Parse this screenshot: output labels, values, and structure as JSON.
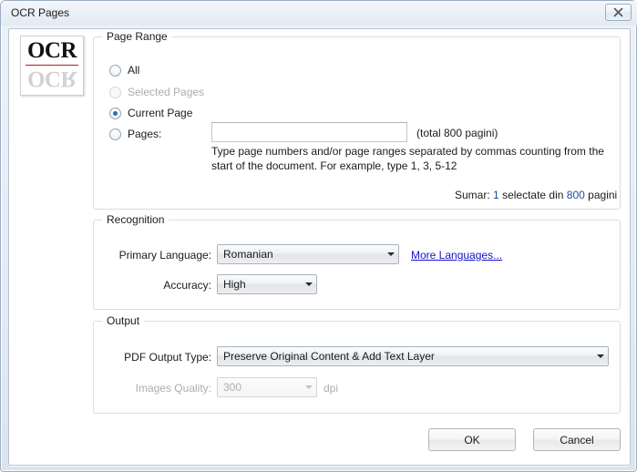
{
  "window": {
    "title": "OCR Pages",
    "close_glyph": "✖"
  },
  "logo": {
    "top_text": "OCR",
    "bottom_text": "OCR"
  },
  "page_range": {
    "title": "Page Range",
    "options": [
      {
        "label": "All",
        "selected": false,
        "disabled": false
      },
      {
        "label": "Selected Pages",
        "selected": false,
        "disabled": true
      },
      {
        "label": "Current Page",
        "selected": true,
        "disabled": false
      },
      {
        "label": "Pages:",
        "selected": false,
        "disabled": false
      }
    ],
    "pages_value": "",
    "pages_placeholder": "",
    "total_label": "(total 800 pagini)",
    "hint": "Type page numbers and/or page ranges separated by commas counting from the start of the document. For example, type 1, 3, 5-12",
    "summary": {
      "prefix": "Sumar:",
      "selected_count": "1",
      "middle": "selectate din",
      "total_count": "800",
      "suffix": "pagini"
    }
  },
  "recognition": {
    "title": "Recognition",
    "primary_language_label": "Primary Language:",
    "primary_language_value": "Romanian",
    "more_languages_link": "More Languages...",
    "accuracy_label": "Accuracy:",
    "accuracy_value": "High"
  },
  "output": {
    "title": "Output",
    "pdf_output_type_label": "PDF Output Type:",
    "pdf_output_type_value": "Preserve Original Content & Add Text Layer",
    "images_quality_label": "Images Quality:",
    "images_quality_value": "300",
    "images_quality_unit": "dpi"
  },
  "buttons": {
    "ok": "OK",
    "cancel": "Cancel"
  },
  "colors": {
    "link": "#1313c8",
    "accent_number": "#1d4fa0",
    "radio_dot": "#2a6fb0",
    "logo_rule": "#a82020"
  }
}
